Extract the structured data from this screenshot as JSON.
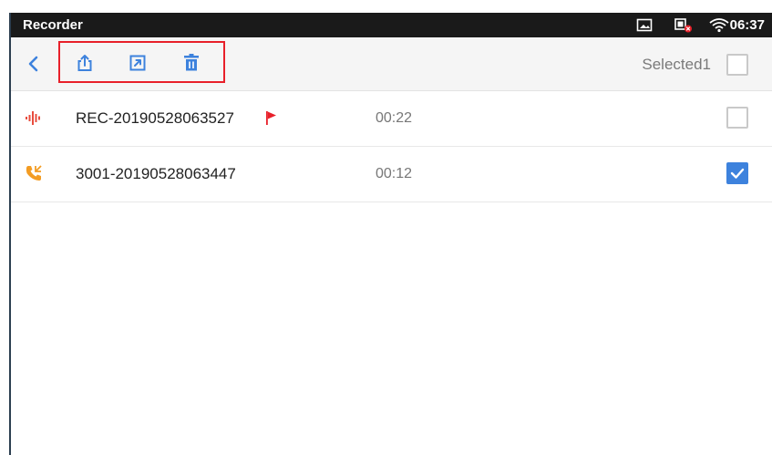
{
  "status_bar": {
    "title": "Recorder",
    "time": "06:37",
    "icons": [
      "screenshot-icon",
      "network-error-icon",
      "wifi-icon"
    ]
  },
  "toolbar": {
    "buttons": [
      "back-icon",
      "share-icon",
      "export-icon",
      "delete-icon"
    ],
    "selected_label": "Selected1",
    "accent_color": "#3d82dd",
    "highlight_color": "#e8202a"
  },
  "recordings": [
    {
      "name": "REC-20190528063527",
      "duration": "00:22",
      "icon": "waveform-icon",
      "flagged": true,
      "checked": false
    },
    {
      "name": "3001-20190528063447",
      "duration": "00:12",
      "icon": "phone-call-icon",
      "flagged": false,
      "checked": true
    }
  ]
}
